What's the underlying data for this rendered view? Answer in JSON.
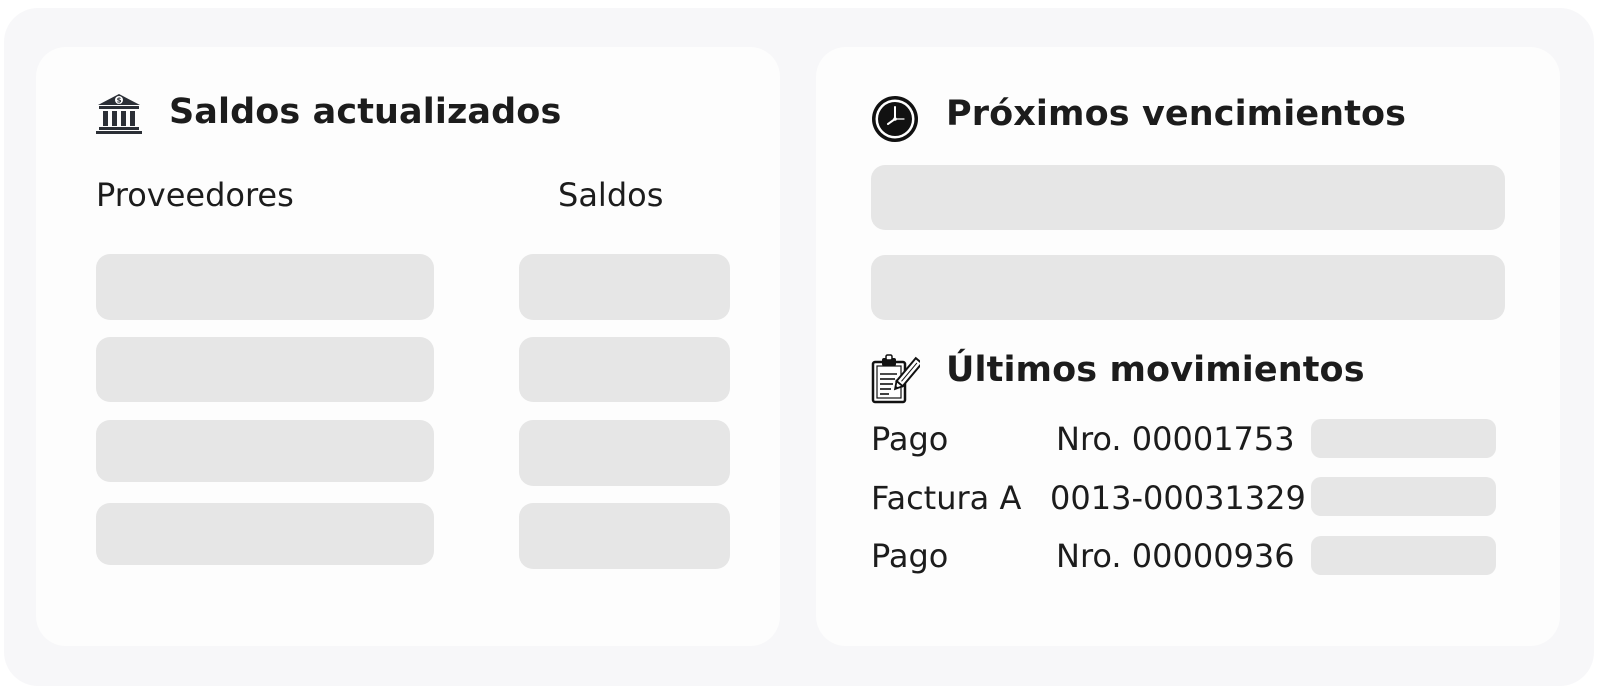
{
  "saldos": {
    "title": "Saldos actualizados",
    "icon": "bank-icon",
    "col_proveedores": "Proveedores",
    "col_saldos": "Saldos"
  },
  "vencimientos": {
    "title": "Próximos vencimientos",
    "icon": "clock-icon"
  },
  "movimientos": {
    "title": "Últimos movimientos",
    "icon": "clipboard-pencil-icon",
    "rows": [
      {
        "type": "Pago",
        "number": "Nro. 00001753"
      },
      {
        "type": "Factura A",
        "number": "0013-00031329"
      },
      {
        "type": "Pago",
        "number": "Nro. 00000936"
      }
    ]
  },
  "colors": {
    "panel_bg": "#f7f7f9",
    "card_bg": "#fdfdfd",
    "placeholder": "#e6e6e6",
    "text": "#1c1c1c",
    "icon_dark": "#2b2f36"
  }
}
